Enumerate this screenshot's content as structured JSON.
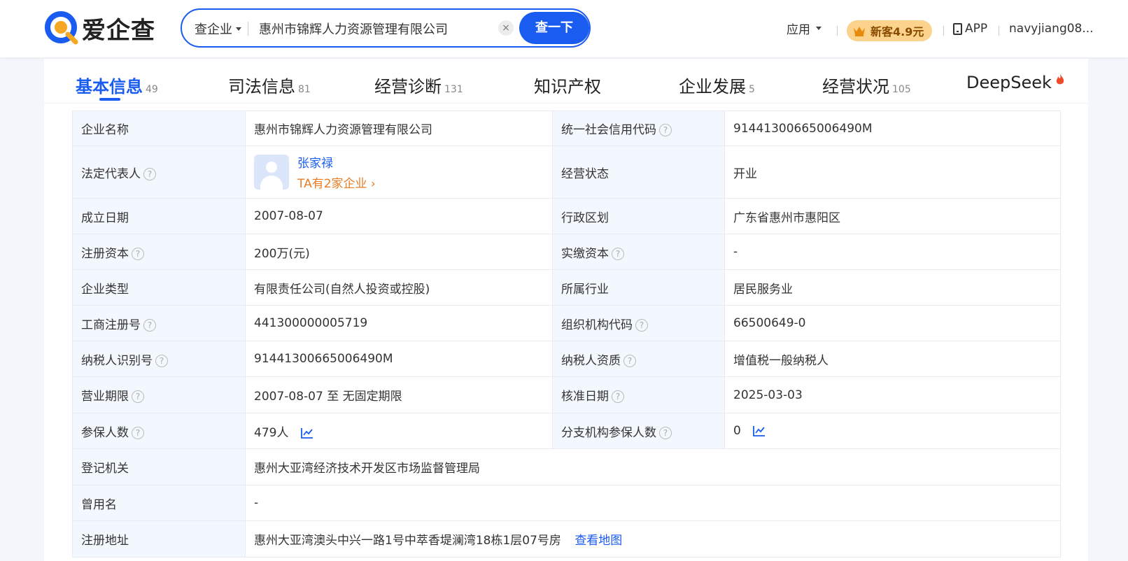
{
  "header": {
    "logo_text": "爱企查",
    "search": {
      "type_label": "查企业",
      "query": "惠州市锦辉人力资源管理有限公司",
      "clear_symbol": "×",
      "button_label": "查一下"
    },
    "apps_label": "应用",
    "promo_label": "新客4.9元",
    "app_label": "APP",
    "username": "navyjiang08..."
  },
  "tabs": [
    {
      "label": "基本信息",
      "count": "49"
    },
    {
      "label": "司法信息",
      "count": "81"
    },
    {
      "label": "经营诊断",
      "count": "131"
    },
    {
      "label": "知识产权",
      "count": ""
    },
    {
      "label": "企业发展",
      "count": "5"
    },
    {
      "label": "经营状况",
      "count": "105"
    },
    {
      "label": "DeepSeek",
      "count": ""
    }
  ],
  "info": {
    "company_name_label": "企业名称",
    "company_name": "惠州市锦辉人力资源管理有限公司",
    "credit_code_label": "统一社会信用代码",
    "credit_code": "91441300665006490M",
    "legal_rep_label": "法定代表人",
    "legal_rep_name": "张家禄",
    "legal_rep_companies": "TA有2家企业",
    "status_label": "经营状态",
    "status": "开业",
    "found_date_label": "成立日期",
    "found_date": "2007-08-07",
    "region_label": "行政区划",
    "region": "广东省惠州市惠阳区",
    "reg_capital_label": "注册资本",
    "reg_capital": "200万(元)",
    "paid_capital_label": "实缴资本",
    "paid_capital": "-",
    "company_type_label": "企业类型",
    "company_type": "有限责任公司(自然人投资或控股)",
    "industry_label": "所属行业",
    "industry": "居民服务业",
    "biz_reg_no_label": "工商注册号",
    "biz_reg_no": "441300000005719",
    "org_code_label": "组织机构代码",
    "org_code": "66500649-0",
    "taxpayer_id_label": "纳税人识别号",
    "taxpayer_id": "91441300665006490M",
    "taxpayer_qual_label": "纳税人资质",
    "taxpayer_qual": "增值税一般纳税人",
    "biz_term_label": "营业期限",
    "biz_term": "2007-08-07 至 无固定期限",
    "approval_date_label": "核准日期",
    "approval_date": "2025-03-03",
    "insured_label": "参保人数",
    "insured": "479人",
    "branch_insured_label": "分支机构参保人数",
    "branch_insured": "0",
    "reg_authority_label": "登记机关",
    "reg_authority": "惠州大亚湾经济技术开发区市场监督管理局",
    "former_name_label": "曾用名",
    "former_name": "-",
    "reg_address_label": "注册地址",
    "reg_address": "惠州大亚湾澳头中兴一路1号中萃香堤澜湾18栋1层07号房",
    "map_link": "查看地图"
  },
  "help_symbol": "?",
  "colors": {
    "brand": "#1a5cf0",
    "accent_orange": "#e97c24",
    "promo_bg": "#fbd38d"
  }
}
